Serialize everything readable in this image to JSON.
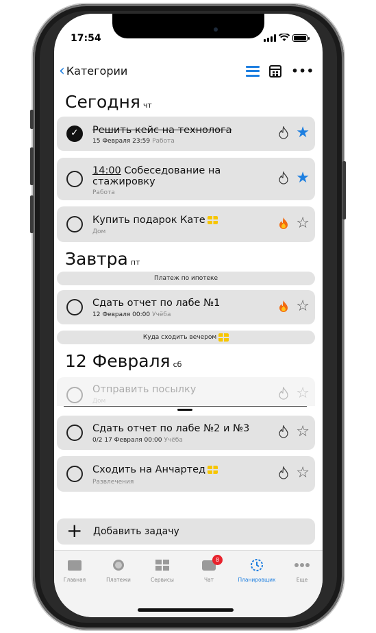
{
  "status_bar": {
    "time": "17:54"
  },
  "nav": {
    "back_label": "Категории"
  },
  "sections": [
    {
      "title": "Сегодня",
      "weekday": "чт"
    },
    {
      "title": "Завтра",
      "weekday": "пт"
    },
    {
      "title": "12 Февраля",
      "weekday": "сб"
    }
  ],
  "tasks": [
    {
      "title": "Решить кейс на технолога",
      "date": "15 Февраля 23:59",
      "category": "Работа",
      "done": true,
      "starred": true,
      "hot": false
    },
    {
      "time": "14:00",
      "title": "Собеседование на стажировку",
      "category": "Работа",
      "done": false,
      "starred": true,
      "hot": false
    },
    {
      "title": "Купить подарок Кате",
      "category": "Дом",
      "done": false,
      "starred": false,
      "hot": true,
      "has_note_icon": true
    },
    {
      "title": "Сдать отчет по лабе №1",
      "date": "12 Февраля 00:00",
      "category": "Учёба",
      "done": false,
      "starred": false,
      "hot": true
    },
    {
      "title": "Отправить посылку",
      "category": "Дом",
      "done": false,
      "starred": false,
      "hot": false,
      "dragging": true
    },
    {
      "title": "Сдать отчет по лабе №2 и №3",
      "progress": "0/2",
      "date": "17 Февраля 00:00",
      "category": "Учёба",
      "done": false,
      "starred": false,
      "hot": false
    },
    {
      "title": "Сходить на Анчартед",
      "category": "Развлечения",
      "done": false,
      "starred": false,
      "hot": false,
      "has_note_icon": true
    }
  ],
  "events": [
    {
      "label": "Платеж по ипотеке"
    },
    {
      "label": "Куда сходить вечером",
      "has_note_icon": true
    }
  ],
  "add_task": {
    "label": "Добавить задачу"
  },
  "tabbar": {
    "items": [
      {
        "label": "Главная",
        "icon": "card-icon"
      },
      {
        "label": "Платежи",
        "icon": "circle-icon"
      },
      {
        "label": "Сервисы",
        "icon": "grid-icon"
      },
      {
        "label": "Чат",
        "icon": "chat-icon",
        "badge": "8"
      },
      {
        "label": "Планировщик",
        "icon": "planner-icon",
        "active": true
      },
      {
        "label": "Еще",
        "icon": "more-icon"
      }
    ]
  },
  "colors": {
    "accent": "#1e7fe0",
    "card": "#e3e3e3",
    "badge": "#e8222c",
    "note": "#f7c600"
  }
}
